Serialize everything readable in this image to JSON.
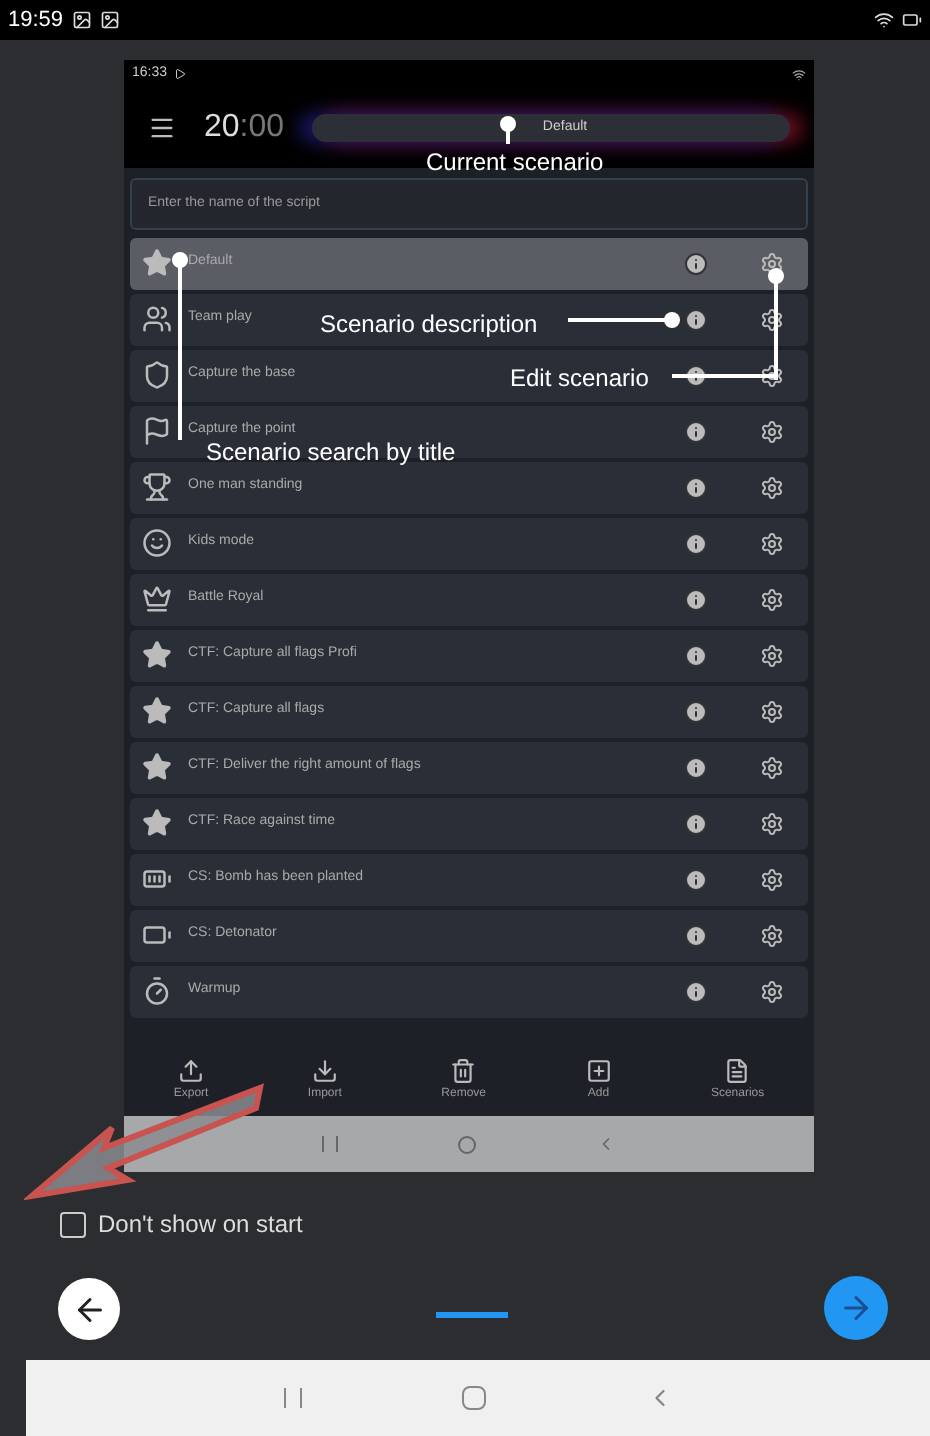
{
  "status_bar": {
    "time": "19:59"
  },
  "inner_screen": {
    "status_bar": {
      "time": "16:33"
    },
    "header": {
      "timer_main": "20",
      "timer_rest": ":00",
      "current_scenario": "Default"
    },
    "search": {
      "placeholder": "Enter the name of the script"
    },
    "scenarios": [
      {
        "name": "Default",
        "selected": true
      },
      {
        "name": "Team play",
        "selected": false
      },
      {
        "name": "Capture the base",
        "selected": false
      },
      {
        "name": "Capture the point",
        "selected": false
      },
      {
        "name": "One man standing",
        "selected": false
      },
      {
        "name": "Kids mode",
        "selected": false
      },
      {
        "name": "Battle Royal",
        "selected": false
      },
      {
        "name": "CTF: Capture all flags Profi",
        "selected": false
      },
      {
        "name": "CTF: Capture all flags",
        "selected": false
      },
      {
        "name": "CTF: Deliver the right amount of flags",
        "selected": false
      },
      {
        "name": "CTF: Race against time",
        "selected": false
      },
      {
        "name": "CS: Bomb has been planted",
        "selected": false
      },
      {
        "name": "CS: Detonator",
        "selected": false
      },
      {
        "name": "Warmup",
        "selected": false
      }
    ],
    "toolbar": [
      "Export",
      "Import",
      "Remove",
      "Add",
      "Scenarios"
    ]
  },
  "annotations": {
    "current_scenario": "Current scenario",
    "description": "Scenario description",
    "edit": "Edit scenario",
    "search": "Scenario search by title"
  },
  "dont_show": {
    "label": "Don't show on start",
    "checked": false
  },
  "pager": {
    "page_selected": true
  }
}
